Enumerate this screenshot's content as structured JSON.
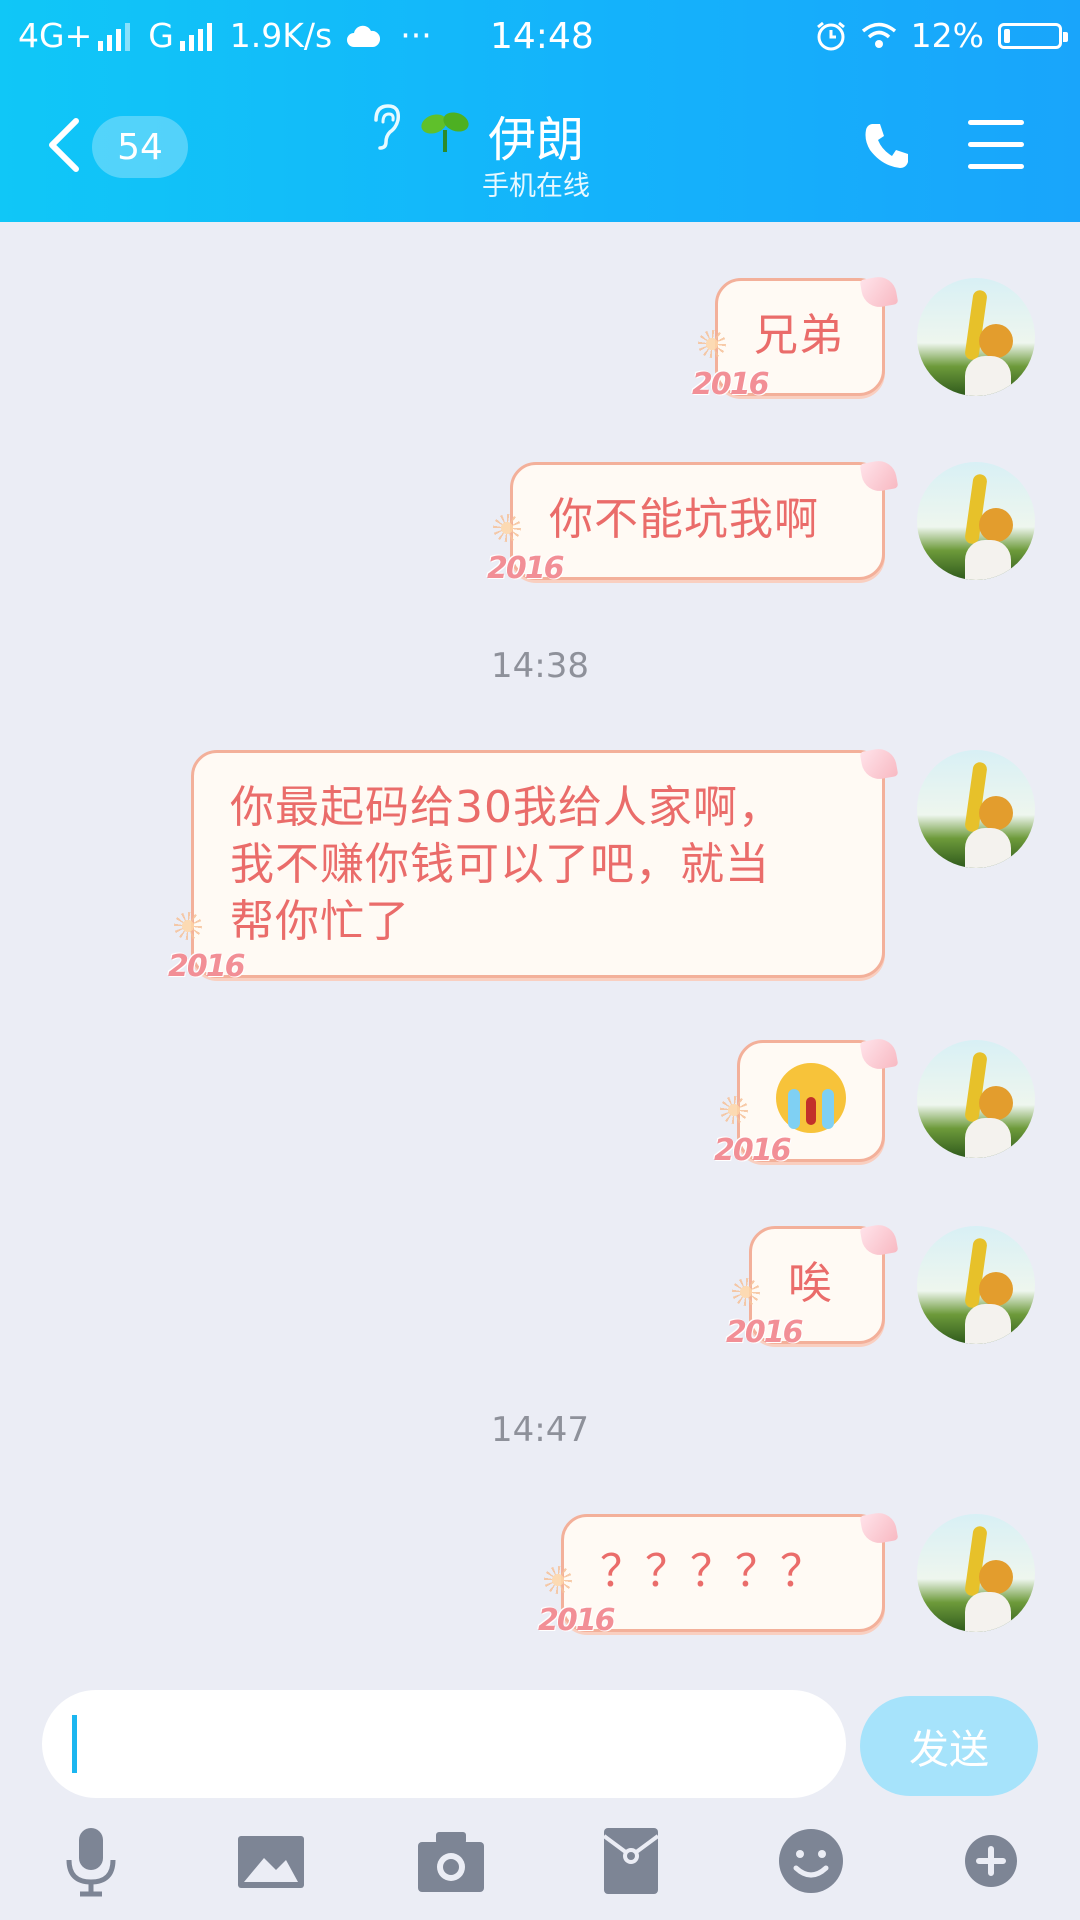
{
  "status_bar": {
    "network1": "4G+",
    "network2": "G",
    "speed": "1.9K/s",
    "more": "···",
    "time": "14:48",
    "battery": "12%",
    "battery_level": 0.12
  },
  "header": {
    "unread_count": "54",
    "contact_name": "伊朗",
    "contact_status": "手机在线"
  },
  "messages": [
    {
      "text": "兄弟",
      "deco": "2016"
    },
    {
      "text": "你不能坑我啊",
      "deco": "2016"
    },
    {
      "timestamp": "14:38"
    },
    {
      "text": "你最起码给30我给人家啊，\n我不赚你钱可以了吧，就当\n帮你忙了",
      "deco": "2016"
    },
    {
      "emoji": "crying-face",
      "deco": "2016"
    },
    {
      "text": "唉",
      "deco": "2016"
    },
    {
      "timestamp": "14:47"
    },
    {
      "text": "？？？？？",
      "deco": "2016"
    }
  ],
  "input": {
    "placeholder": "",
    "send_label": "发送"
  },
  "toolbar": {
    "icons": [
      "microphone-icon",
      "image-icon",
      "camera-icon",
      "red-packet-icon",
      "emoji-icon",
      "plus-icon"
    ]
  },
  "colors": {
    "header_start": "#10c7f7",
    "header_end": "#19a5fb",
    "bubble_text": "#ea6c6a",
    "bubble_border": "#f3b09a",
    "background": "#ebedf5",
    "send_button": "#a6e3fb"
  }
}
